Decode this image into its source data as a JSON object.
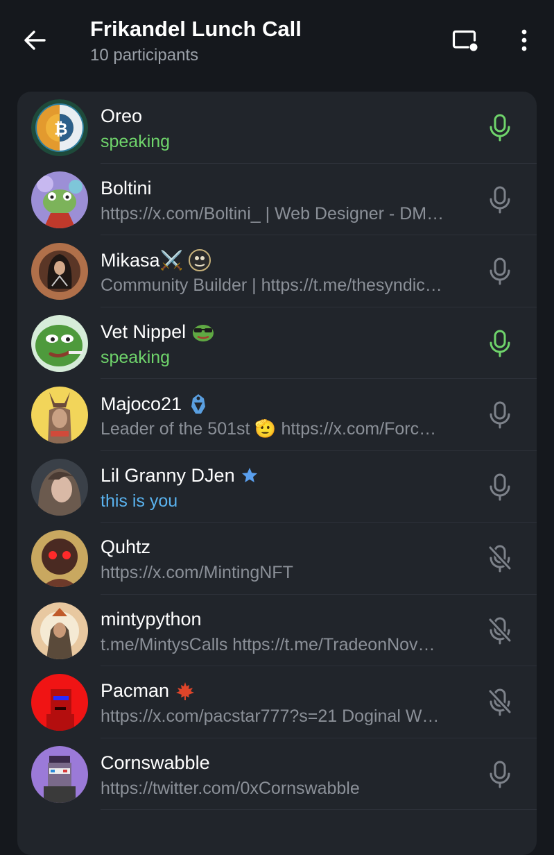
{
  "header": {
    "title": "Frikandel Lunch Call",
    "subtitle": "10 participants"
  },
  "colors": {
    "background": "#15181d",
    "panel": "#21252b",
    "speaking": "#6fd46b",
    "self": "#5ab3ef",
    "muted_text": "#8b9098",
    "mic_idle": "#7d828a"
  },
  "participants": [
    {
      "name": "Oreo",
      "status": "speaking",
      "status_type": "speaking",
      "mic": "speaking",
      "badges": [],
      "avatar": "bitcoin-coin-avatar"
    },
    {
      "name": "Boltini",
      "status": "https://x.com/Boltini_ | Web Designer - DM…",
      "status_type": "bio",
      "mic": "on",
      "badges": [],
      "avatar": "frog-art-avatar"
    },
    {
      "name": "Mikasa⚔️",
      "status": "Community Builder | https://t.me/thesyndic…",
      "status_type": "bio",
      "mic": "on",
      "badges": [
        "custom-emoji-badge"
      ],
      "avatar": "hooded-figure-avatar"
    },
    {
      "name": "Vet Nippel",
      "status": "speaking",
      "status_type": "speaking",
      "mic": "speaking",
      "badges": [
        "pepe-sunglasses-emoji"
      ],
      "avatar": "pepe-frog-avatar"
    },
    {
      "name": "Majoco21",
      "status": "Leader of the 501st 🫡 https://x.com/Forc…",
      "status_type": "bio",
      "mic": "on",
      "badges": [
        "mandalorian-emblem-badge"
      ],
      "avatar": "anubis-warrior-avatar"
    },
    {
      "name": "Lil Granny DJen",
      "status": "this is you",
      "status_type": "self",
      "mic": "on",
      "badges": [
        "star-badge"
      ],
      "avatar": "woman-portrait-avatar"
    },
    {
      "name": "Quhtz",
      "status": "https://x.com/MintingNFT",
      "status_type": "bio",
      "mic": "muted",
      "badges": [],
      "avatar": "red-eyes-mask-avatar"
    },
    {
      "name": "mintypython",
      "status": "t.me/MintysCalls https://t.me/TradeonNov…",
      "status_type": "bio",
      "mic": "muted",
      "badges": [],
      "avatar": "wizard-portrait-avatar"
    },
    {
      "name": "Pacman",
      "status": "https://x.com/pacstar777?s=21 Doginal W…",
      "status_type": "bio",
      "mic": "muted",
      "badges": [
        "maple-leaf-emoji"
      ],
      "avatar": "pixel-punk-avatar"
    },
    {
      "name": "Cornswabble",
      "status": "https://twitter.com/0xCornswabble",
      "status_type": "bio",
      "mic": "on",
      "badges": [],
      "avatar": "pixel-cyborg-avatar"
    }
  ]
}
